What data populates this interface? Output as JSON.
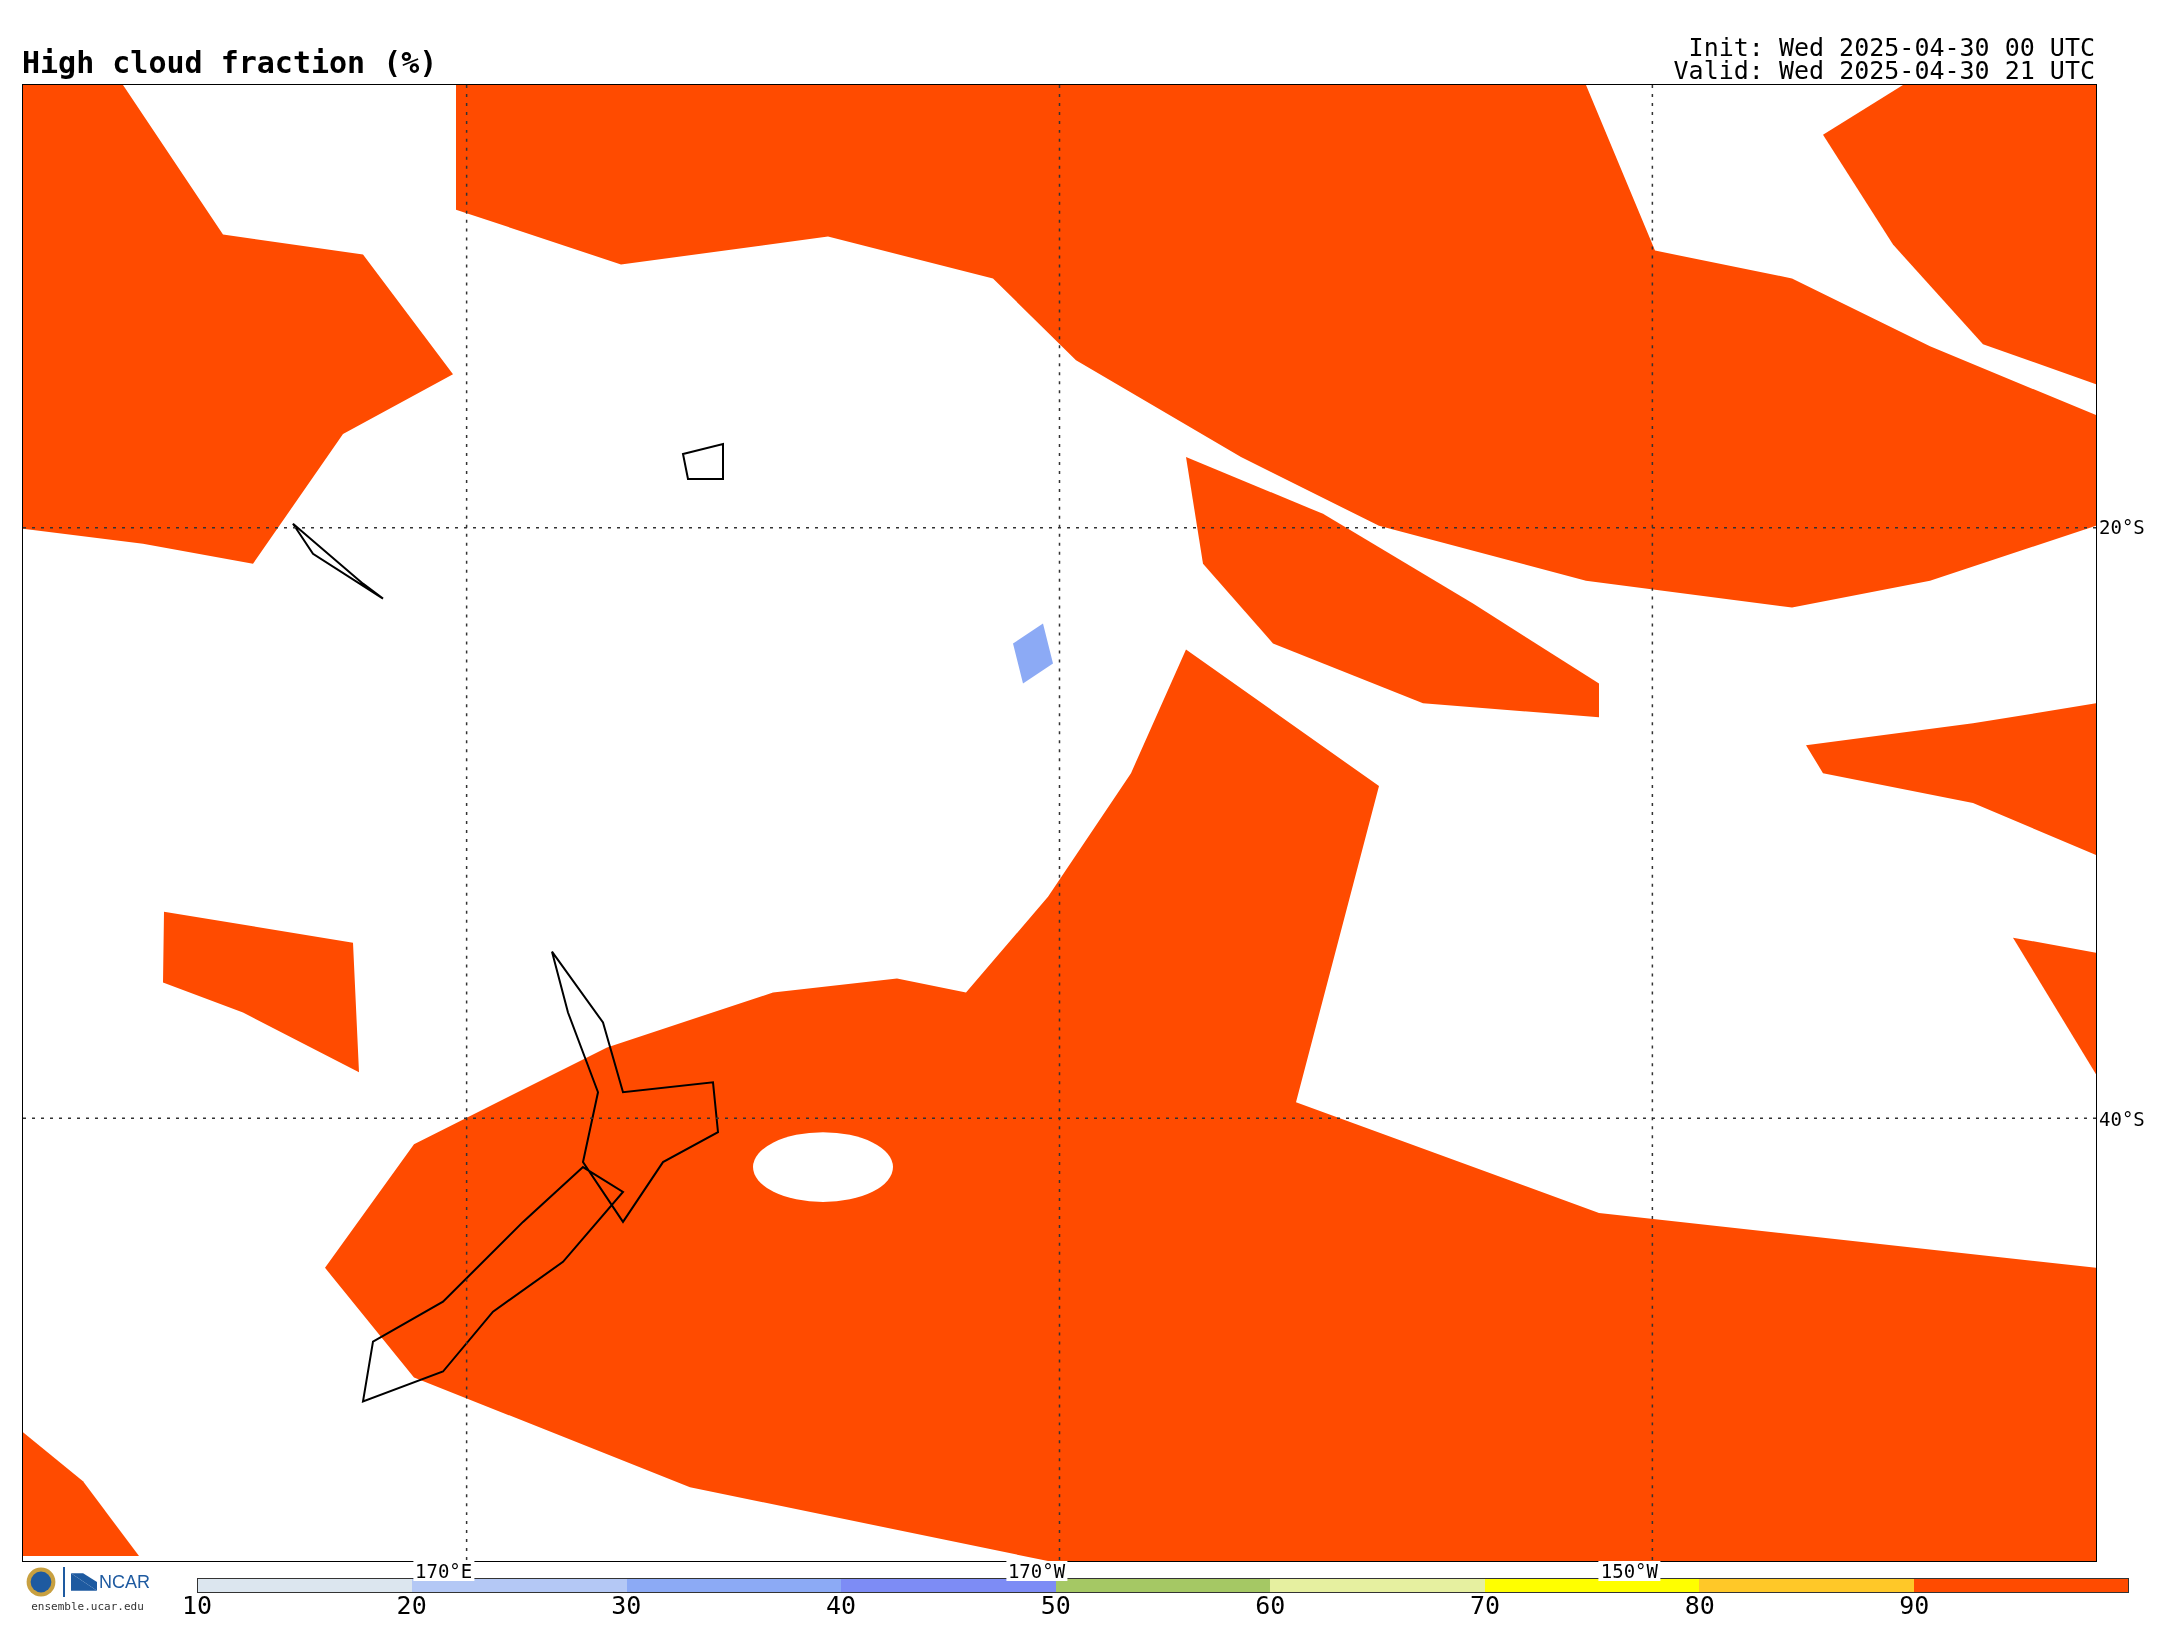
{
  "title": "High cloud fraction (%)",
  "init": "Init: Wed 2025-04-30 00 UTC",
  "valid": "Valid: Wed 2025-04-30 21 UTC",
  "map": {
    "lon_labels": [
      {
        "label": "170°E"
      },
      {
        "label": "170°W"
      },
      {
        "label": "150°W"
      }
    ],
    "lat_labels": [
      {
        "label": "20°S"
      },
      {
        "label": "40°S"
      }
    ]
  },
  "logo": {
    "org": "NCAR",
    "site": "ensemble.ucar.edu"
  },
  "colorbar": {
    "ticks": [
      "10",
      "20",
      "30",
      "40",
      "50",
      "60",
      "70",
      "80",
      "90"
    ],
    "bins": [
      {
        "color": "#dce6ef"
      },
      {
        "color": "#b4c8f5"
      },
      {
        "color": "#8caaf5"
      },
      {
        "color": "#7d8cf5"
      },
      {
        "color": "#a5c864"
      },
      {
        "color": "#e6f0a0"
      },
      {
        "color": "#ffff00"
      },
      {
        "color": "#ffc828"
      },
      {
        "color": "#ff4b00"
      }
    ]
  }
}
